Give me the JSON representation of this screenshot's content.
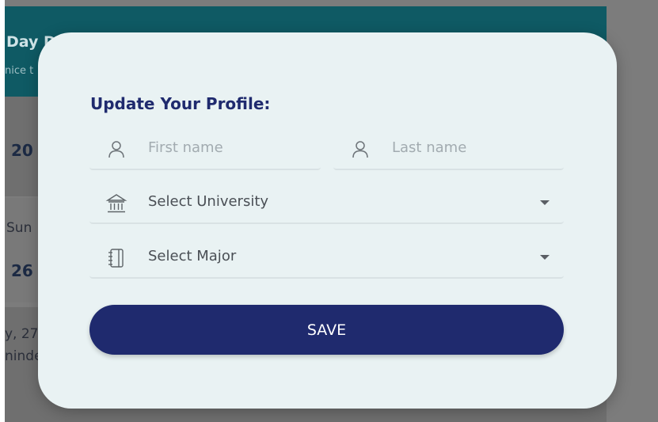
{
  "background": {
    "header_title": "Day Di... Thi...",
    "header_subtitle": "nice t",
    "row_year": "20",
    "row_day_name": "Sun",
    "row_day_number": "26",
    "row_date_line": "y, 27",
    "row_reminder_line": "ninde"
  },
  "modal": {
    "title": "Update Your Profile:",
    "first_name": {
      "placeholder": "First name",
      "icon": "person-icon"
    },
    "last_name": {
      "placeholder": "Last name",
      "icon": "person-icon"
    },
    "university": {
      "value": "Select University",
      "icon": "university-icon"
    },
    "major": {
      "value": "Select Major",
      "icon": "notebook-icon"
    },
    "save_label": "SAVE"
  },
  "colors": {
    "primary": "#1f2a6e",
    "header": "#0f5a64",
    "modal_bg": "#e9f2f3"
  }
}
